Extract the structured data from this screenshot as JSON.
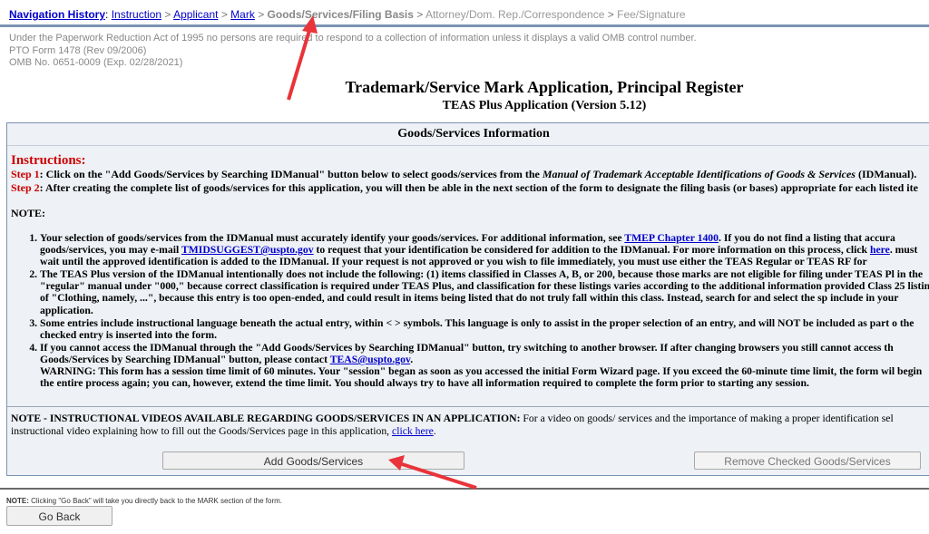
{
  "nav": {
    "title": "Navigation History",
    "separator": ">",
    "links": [
      "Instruction",
      "Applicant",
      "Mark"
    ],
    "current": "Goods/Services/Filing Basis",
    "future": [
      "Attorney/Dom. Rep./Correspondence",
      "Fee/Signature"
    ]
  },
  "paperwork": {
    "line1": "Under the Paperwork Reduction Act of 1995 no persons are required to respond to a collection of information unless it displays a valid OMB control number.",
    "line2": "PTO Form 1478 (Rev 09/2006)",
    "line3": "OMB No. 0651-0009 (Exp. 02/28/2021)"
  },
  "title": "Trademark/Service Mark Application, Principal Register",
  "subtitle": "TEAS Plus Application (Version 5.12)",
  "panel": {
    "header": "Goods/Services Information",
    "instructions_title": "Instructions:",
    "step1_label": "Step 1",
    "step1_pre": ": Click on the \"Add Goods/Services by Searching IDManual\" button below to select goods/services from the ",
    "step1_italic": "Manual of Trademark Acceptable Identifications of Goods & Services",
    "step1_post": " (IDManual).",
    "step2_label": "Step 2",
    "step2_text": ": After creating the complete list of goods/services for this application, you will then be able in the next section of the form to designate the filing basis (or bases) appropriate for each listed ite",
    "note_title": "NOTE:",
    "notes": {
      "n1_a": "Your selection of goods/services from the IDManual must accurately identify your goods/services. For additional information, see ",
      "n1_link1": "TMEP Chapter 1400",
      "n1_b": ". If you do not find a listing that accura goods/services, you may e-mail ",
      "n1_link2": "TMIDSUGGEST@uspto.gov",
      "n1_c": " to request that your identification be considered for addition to the IDManual. For more information on this process, click ",
      "n1_link3": "here",
      "n1_d": ". must wait until the approved identification is added to the IDManual. If your request is not approved or you wish to file immediately, you must use either the TEAS Regular or TEAS RF for",
      "n2": "The TEAS Plus version of the IDManual intentionally does not include the following: (1) items classified in Classes A, B, or 200, because those marks are not eligible for filing under TEAS Pl in the \"regular\" manual under \"000,\" because correct classification is required under TEAS Plus, and classification for these listings varies according to the additional information provided Class 25 listing of \"Clothing, namely, ...\", because this entry is too open-ended, and could result in items being listed that do not truly fall within this class. Instead, search for and select the sp include in your application.",
      "n3": "Some entries include instructional language beneath the actual entry, within < > symbols. This language is only to assist in the proper selection of an entry, and will NOT be included as part o the checked entry is inserted into the form.",
      "n4_a": "If you cannot access the IDManual through the \"Add Goods/Services by Searching IDManual\" button, try switching to another browser. If after changing browsers you still cannot access th Goods/Services by Searching IDManual\" button, please contact ",
      "n4_link": "TEAS@uspto.gov",
      "n4_b": ".",
      "n4_warning": "WARNING: This form has a session time limit of 60 minutes. Your \"session\" began as soon as you accessed the initial Form Wizard page. If you exceed the 60-minute time limit, the form wil begin the entire process again; you can, however, extend the time limit. You should always try to have all information required to complete the form prior to starting any session."
    },
    "video_bold": "NOTE - INSTRUCTIONAL VIDEOS AVAILABLE REGARDING GOODS/SERVICES IN AN APPLICATION:",
    "video_text": " For a video on goods/ services and the importance of making a proper identification sel instructional video explaining how to fill out the Goods/Services page in this application, ",
    "video_link": "click here",
    "video_end": ".",
    "add_button": "Add Goods/Services",
    "remove_button": "Remove Checked Goods/Services"
  },
  "footer": {
    "note_bold": "NOTE:",
    "note_text": " Clicking \"Go Back\" will take you directly back to the MARK section of the form.",
    "go_back": "Go Back"
  },
  "colors": {
    "annotation_arrow": "#e8343a",
    "link": "#0000cc",
    "instruction_red": "#cc0000"
  }
}
